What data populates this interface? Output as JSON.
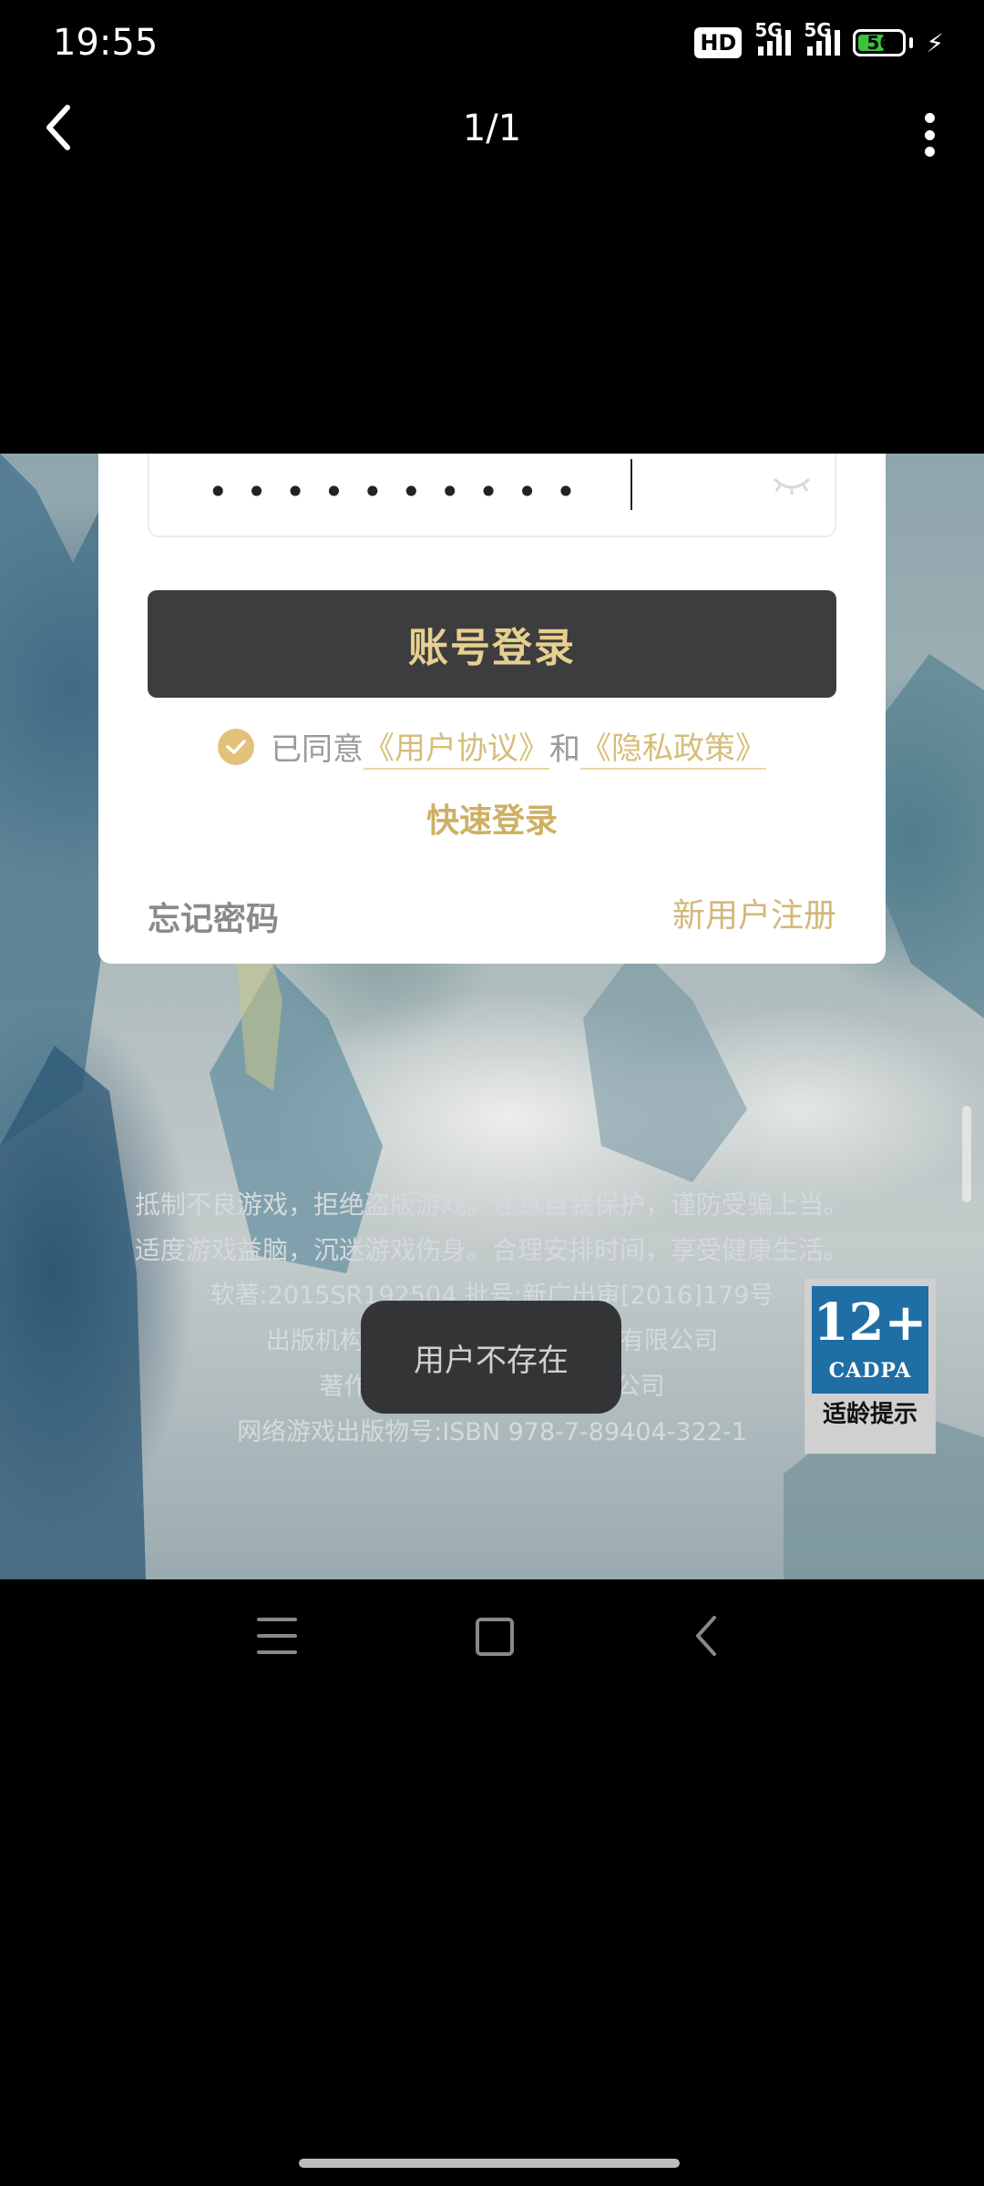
{
  "status_bar": {
    "time": "19:55",
    "hd_badge": "HD",
    "signal1_label": "5G",
    "signal2_label": "5G",
    "battery_level": "56"
  },
  "viewer": {
    "page_counter": "1/1",
    "back_icon": "chevron-left-icon",
    "more_icon": "more-vertical-icon"
  },
  "login": {
    "password_mask": "••••••••••",
    "login_button": "账号登录",
    "agree_prefix": "已同意",
    "user_agreement": "《用户协议》",
    "agree_and": "和",
    "privacy_policy": "《隐私政策》",
    "quick_login": "快速登录",
    "forgot_password": "忘记密码",
    "register": "新用户注册"
  },
  "notices": {
    "line1": "抵制不良游戏，拒绝盗版游戏。注意自我保护，谨防受骗上当。",
    "line2": "适度游戏益脑，沉迷游戏伤身。合理安排时间，享受健康生活。",
    "line3": "软著:2015SR192504 批号:新广出审[2016]179号",
    "line4": "出版机构:上海                   版社有限公司",
    "line5": "著作权单                   有限公司",
    "line6": "网络游戏出版物号:ISBN 978-7-89404-322-1"
  },
  "toast": "用户不存在",
  "age_badge": {
    "rating": "12+",
    "org": "CADPA",
    "hint": "适龄提示"
  },
  "colors": {
    "accent_gold": "#d6bd7a",
    "button_dark": "#3d3d3f",
    "badge_blue": "#1f6ea4"
  }
}
